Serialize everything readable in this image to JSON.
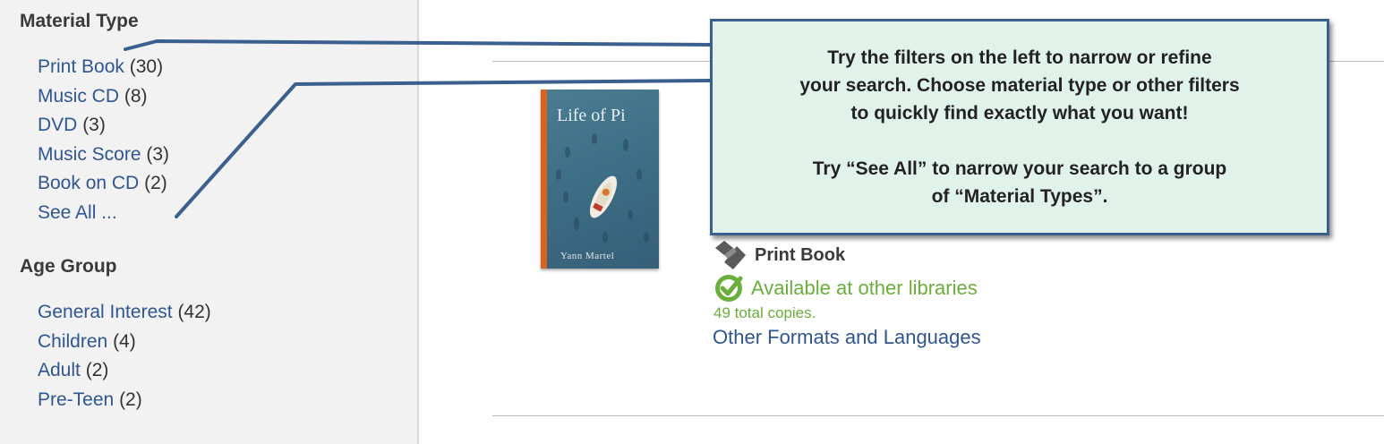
{
  "sidebar": {
    "material_type": {
      "heading": "Material Type",
      "items": [
        {
          "label": "Print Book",
          "count": "(30)"
        },
        {
          "label": "Music CD",
          "count": "(8)"
        },
        {
          "label": "DVD",
          "count": "(3)"
        },
        {
          "label": "Music Score",
          "count": "(3)"
        },
        {
          "label": "Book on CD",
          "count": "(2)"
        }
      ],
      "see_all": "See All ..."
    },
    "age_group": {
      "heading": "Age Group",
      "items": [
        {
          "label": "General Interest",
          "count": "(42)"
        },
        {
          "label": "Children",
          "count": "(4)"
        },
        {
          "label": "Adult",
          "count": "(2)"
        },
        {
          "label": "Pre-Teen",
          "count": "(2)"
        }
      ]
    }
  },
  "result": {
    "cover": {
      "title": "Life of Pi",
      "author": "Yann Martel"
    },
    "format": "Print Book",
    "availability": "Available at other libraries",
    "copies": "49 total copies.",
    "other_formats": "Other Formats and Languages"
  },
  "callout": {
    "para1": [
      "Try the filters on the left to narrow or refine",
      "your search.  Choose material type or other filters",
      "to quickly find exactly what you want!"
    ],
    "para2": [
      "Try “See All” to narrow your search to a group",
      "of “Material Types”."
    ]
  },
  "colors": {
    "link": "#2f5592",
    "available": "#6aae3b",
    "callout_bg": "#e1f2ea",
    "callout_border": "#3b5f8e"
  }
}
